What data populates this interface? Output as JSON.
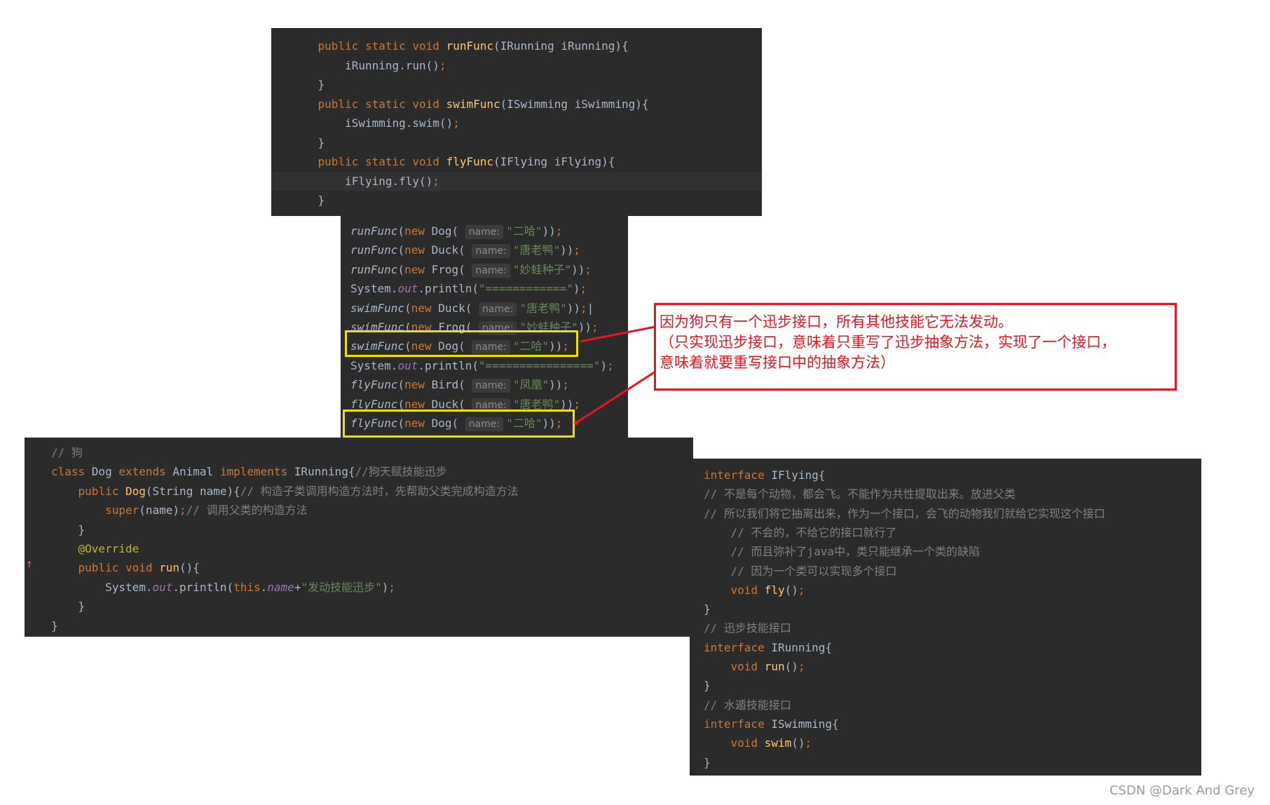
{
  "panel_top": {
    "lines": [
      [
        {
          "t": "    ",
          "c": ""
        },
        {
          "t": "public static void ",
          "c": "kw"
        },
        {
          "t": "runFunc",
          "c": "fn"
        },
        {
          "t": "(IRunning iRunning){",
          "c": ""
        }
      ],
      [
        {
          "t": "        iRunning.run()",
          "c": ""
        },
        {
          "t": ";",
          "c": "kw"
        }
      ],
      [
        {
          "t": "    }",
          "c": ""
        }
      ],
      [
        {
          "t": "    ",
          "c": ""
        },
        {
          "t": "public static void ",
          "c": "kw"
        },
        {
          "t": "swimFunc",
          "c": "fn"
        },
        {
          "t": "(ISwimming iSwimming){",
          "c": ""
        }
      ],
      [
        {
          "t": "        iSwimming.swim()",
          "c": ""
        },
        {
          "t": ";",
          "c": "kw"
        }
      ],
      [
        {
          "t": "    }",
          "c": ""
        }
      ],
      [
        {
          "t": "    ",
          "c": ""
        },
        {
          "t": "public static void ",
          "c": "kw"
        },
        {
          "t": "flyFunc",
          "c": "fn"
        },
        {
          "t": "(IFlying iFlying){",
          "c": ""
        }
      ],
      [
        {
          "t": "        iFlying.fly()",
          "c": ""
        },
        {
          "t": ";",
          "c": "kw"
        }
      ],
      [
        {
          "t": "    }",
          "c": ""
        }
      ]
    ]
  },
  "panel_mid": {
    "hint_label": "name:",
    "lines": [
      [
        {
          "t": "runFunc",
          "c": "fni"
        },
        {
          "t": "(",
          "c": ""
        },
        {
          "t": "new ",
          "c": "kw"
        },
        {
          "t": "Dog( ",
          "c": ""
        },
        {
          "t": "name:",
          "c": "hint"
        },
        {
          "t": "\"二哈\"",
          "c": "str"
        },
        {
          "t": "))",
          "c": ""
        },
        {
          "t": ";",
          "c": "kw"
        }
      ],
      [
        {
          "t": "runFunc",
          "c": "fni"
        },
        {
          "t": "(",
          "c": ""
        },
        {
          "t": "new ",
          "c": "kw"
        },
        {
          "t": "Duck( ",
          "c": ""
        },
        {
          "t": "name:",
          "c": "hint"
        },
        {
          "t": "\"唐老鸭\"",
          "c": "str"
        },
        {
          "t": "))",
          "c": ""
        },
        {
          "t": ";",
          "c": "kw"
        }
      ],
      [
        {
          "t": "runFunc",
          "c": "fni"
        },
        {
          "t": "(",
          "c": ""
        },
        {
          "t": "new ",
          "c": "kw"
        },
        {
          "t": "Frog( ",
          "c": ""
        },
        {
          "t": "name:",
          "c": "hint"
        },
        {
          "t": "\"妙蛙种子\"",
          "c": "str"
        },
        {
          "t": "))",
          "c": ""
        },
        {
          "t": ";",
          "c": "kw"
        }
      ],
      [
        {
          "t": "System.",
          "c": ""
        },
        {
          "t": "out",
          "c": "fld"
        },
        {
          "t": ".println(",
          "c": ""
        },
        {
          "t": "\"============\"",
          "c": "str"
        },
        {
          "t": ")",
          "c": ""
        },
        {
          "t": ";",
          "c": "kw"
        }
      ],
      [
        {
          "t": "swimFunc",
          "c": "fni"
        },
        {
          "t": "(",
          "c": ""
        },
        {
          "t": "new ",
          "c": "kw"
        },
        {
          "t": "Duck( ",
          "c": ""
        },
        {
          "t": "name:",
          "c": "hint"
        },
        {
          "t": "\"唐老鸭\"",
          "c": "str"
        },
        {
          "t": "))",
          "c": ""
        },
        {
          "t": ";",
          "c": "kw"
        },
        {
          "t": "|",
          "c": ""
        }
      ],
      [
        {
          "t": "swimFunc",
          "c": "fni"
        },
        {
          "t": "(",
          "c": ""
        },
        {
          "t": "new ",
          "c": "kw"
        },
        {
          "t": "Frog( ",
          "c": ""
        },
        {
          "t": "name:",
          "c": "hint"
        },
        {
          "t": "\"妙蛙种子\"",
          "c": "str"
        },
        {
          "t": "))",
          "c": ""
        },
        {
          "t": ";",
          "c": "kw"
        }
      ],
      [
        {
          "t": "swimFunc",
          "c": "fni"
        },
        {
          "t": "(",
          "c": ""
        },
        {
          "t": "new ",
          "c": "kw"
        },
        {
          "t": "Dog( ",
          "c": ""
        },
        {
          "t": "name:",
          "c": "hint"
        },
        {
          "t": "\"二哈\"",
          "c": "str"
        },
        {
          "t": "))",
          "c": ""
        },
        {
          "t": ";",
          "c": "kw"
        }
      ],
      [
        {
          "t": "System.",
          "c": ""
        },
        {
          "t": "out",
          "c": "fld"
        },
        {
          "t": ".println(",
          "c": ""
        },
        {
          "t": "\"================\"",
          "c": "str"
        },
        {
          "t": ")",
          "c": ""
        },
        {
          "t": ";",
          "c": "kw"
        }
      ],
      [
        {
          "t": "flyFunc",
          "c": "fni"
        },
        {
          "t": "(",
          "c": ""
        },
        {
          "t": "new ",
          "c": "kw"
        },
        {
          "t": "Bird( ",
          "c": ""
        },
        {
          "t": "name:",
          "c": "hint"
        },
        {
          "t": "\"凤凰\"",
          "c": "str"
        },
        {
          "t": "))",
          "c": ""
        },
        {
          "t": ";",
          "c": "kw"
        }
      ],
      [
        {
          "t": "flyFunc",
          "c": "fni"
        },
        {
          "t": "(",
          "c": ""
        },
        {
          "t": "new ",
          "c": "kw"
        },
        {
          "t": "Duck( ",
          "c": ""
        },
        {
          "t": "name:",
          "c": "hint"
        },
        {
          "t": "\"唐老鸭\"",
          "c": "str"
        },
        {
          "t": "))",
          "c": ""
        },
        {
          "t": ";",
          "c": "kw"
        }
      ],
      [
        {
          "t": "flyFunc",
          "c": "fni"
        },
        {
          "t": "(",
          "c": ""
        },
        {
          "t": "new ",
          "c": "kw"
        },
        {
          "t": "Dog( ",
          "c": ""
        },
        {
          "t": "name:",
          "c": "hint"
        },
        {
          "t": "\"二哈\"",
          "c": "str"
        },
        {
          "t": "))",
          "c": ""
        },
        {
          "t": ";",
          "c": "kw"
        }
      ]
    ]
  },
  "panel_left": {
    "lines": [
      [
        {
          "t": "// 狗",
          "c": "cm"
        }
      ],
      [
        {
          "t": "class ",
          "c": "kw"
        },
        {
          "t": "Dog ",
          "c": ""
        },
        {
          "t": "extends ",
          "c": "kw"
        },
        {
          "t": "Animal ",
          "c": ""
        },
        {
          "t": "implements ",
          "c": "kw"
        },
        {
          "t": "IRunning{",
          "c": ""
        },
        {
          "t": "//狗天赋技能迅步",
          "c": "cm"
        }
      ],
      [
        {
          "t": "    ",
          "c": ""
        },
        {
          "t": "public ",
          "c": "kw"
        },
        {
          "t": "Dog",
          "c": "fn"
        },
        {
          "t": "(String name){",
          "c": ""
        },
        {
          "t": "// 构造子类调用构造方法时，先帮助父类完成构造方法",
          "c": "cm"
        }
      ],
      [
        {
          "t": "        ",
          "c": ""
        },
        {
          "t": "super",
          "c": "kw"
        },
        {
          "t": "(name)",
          "c": ""
        },
        {
          "t": ";",
          "c": "kw"
        },
        {
          "t": "// 调用父类的构造方法",
          "c": "cm"
        }
      ],
      [
        {
          "t": "    }",
          "c": ""
        }
      ],
      [
        {
          "t": "    ",
          "c": ""
        },
        {
          "t": "@Override",
          "c": "ann"
        }
      ],
      [
        {
          "t": "    ",
          "c": ""
        },
        {
          "t": "public void ",
          "c": "kw"
        },
        {
          "t": "run",
          "c": "fn"
        },
        {
          "t": "(){",
          "c": ""
        }
      ],
      [
        {
          "t": "        System.",
          "c": ""
        },
        {
          "t": "out",
          "c": "fld"
        },
        {
          "t": ".println(",
          "c": ""
        },
        {
          "t": "this",
          "c": "kw"
        },
        {
          "t": ".",
          "c": ""
        },
        {
          "t": "name",
          "c": "fld"
        },
        {
          "t": "+",
          "c": ""
        },
        {
          "t": "\"发动技能迅步\"",
          "c": "str"
        },
        {
          "t": ")",
          "c": ""
        },
        {
          "t": ";",
          "c": "kw"
        }
      ],
      [
        {
          "t": "    }",
          "c": ""
        }
      ],
      [
        {
          "t": "}",
          "c": ""
        }
      ]
    ]
  },
  "panel_right": {
    "lines": [
      [
        {
          "t": "interface ",
          "c": "kw"
        },
        {
          "t": "IFlying{",
          "c": ""
        }
      ],
      [
        {
          "t": "// 不是每个动物，都会飞。不能作为共性提取出来。放进父类",
          "c": "cm"
        }
      ],
      [
        {
          "t": "// 所以我们将它抽离出来，作为一个接口，会飞的动物我们就给它实现这个接口",
          "c": "cm"
        }
      ],
      [
        {
          "t": "    // 不会的，不给它的接口就行了",
          "c": "cm"
        }
      ],
      [
        {
          "t": "    // 而且弥补了java中，类只能继承一个类的缺陷",
          "c": "cm"
        }
      ],
      [
        {
          "t": "    // 因为一个类可以实现多个接口",
          "c": "cm"
        }
      ],
      [
        {
          "t": "    ",
          "c": ""
        },
        {
          "t": "void ",
          "c": "kw"
        },
        {
          "t": "fly",
          "c": "fn"
        },
        {
          "t": "()",
          "c": ""
        },
        {
          "t": ";",
          "c": "kw"
        }
      ],
      [
        {
          "t": "}",
          "c": ""
        }
      ],
      [
        {
          "t": "// 迅步技能接口",
          "c": "cm"
        }
      ],
      [
        {
          "t": "interface ",
          "c": "kw"
        },
        {
          "t": "IRunning{",
          "c": ""
        }
      ],
      [
        {
          "t": "    ",
          "c": ""
        },
        {
          "t": "void ",
          "c": "kw"
        },
        {
          "t": "run",
          "c": "fn"
        },
        {
          "t": "()",
          "c": ""
        },
        {
          "t": ";",
          "c": "kw"
        }
      ],
      [
        {
          "t": "}",
          "c": ""
        }
      ],
      [
        {
          "t": "// 水遁技能接口",
          "c": "cm"
        }
      ],
      [
        {
          "t": "interface ",
          "c": "kw"
        },
        {
          "t": "ISwimming{",
          "c": ""
        }
      ],
      [
        {
          "t": "    ",
          "c": ""
        },
        {
          "t": "void ",
          "c": "kw"
        },
        {
          "t": "swim",
          "c": "fn"
        },
        {
          "t": "()",
          "c": ""
        },
        {
          "t": ";",
          "c": "kw"
        }
      ],
      [
        {
          "t": "}",
          "c": ""
        }
      ]
    ]
  },
  "annotation": {
    "line1": "因为狗只有一个迅步接口，所有其他技能它无法发动。",
    "line2": "（只实现迅步接口，意味着只重写了迅步抽象方法，实现了一个接口，",
    "line3": "意味着就要重写接口中的抽象方法）"
  },
  "watermark": "CSDN @Dark And Grey",
  "colors": {
    "editor_bg": "#2b2b2b",
    "keyword": "#cc7832",
    "function": "#ffc66d",
    "string": "#6a8759",
    "comment": "#808080",
    "highlight_box": "#f0e000",
    "annotation_red": "#e8141e"
  }
}
